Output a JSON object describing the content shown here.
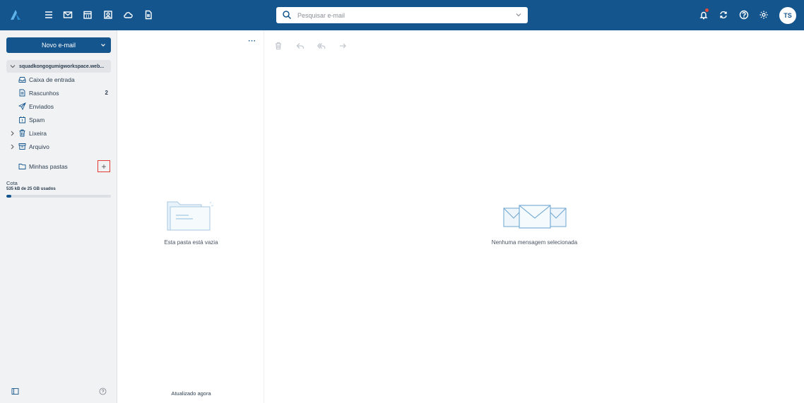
{
  "topbar": {
    "search_placeholder": "Pesquisar e-mail",
    "avatar_initials": "TS",
    "nav_icons": [
      "menu-icon",
      "mail-icon",
      "calendar-icon",
      "contacts-icon",
      "cloud-icon",
      "document-icon"
    ],
    "right_icons": [
      "bell-icon",
      "sync-icon",
      "help-icon",
      "settings-icon"
    ],
    "accent_color": "#14558d",
    "notification_dot_color": "#e74c3c"
  },
  "sidebar": {
    "new_mail_label": "Novo e-mail",
    "account_label": "squadkongogumigworkspace.web...",
    "folders": [
      {
        "label": "Caixa de entrada",
        "icon": "inbox-icon",
        "count": ""
      },
      {
        "label": "Rascunhos",
        "icon": "draft-icon",
        "count": "2"
      },
      {
        "label": "Enviados",
        "icon": "send-icon",
        "count": ""
      },
      {
        "label": "Spam",
        "icon": "spam-icon",
        "count": ""
      },
      {
        "label": "Lixeira",
        "icon": "trash-icon",
        "count": ""
      },
      {
        "label": "Arquivo",
        "icon": "archive-icon",
        "count": ""
      }
    ],
    "my_folders_label": "Minhas pastas",
    "quota_label": "Cota",
    "quota_usage": "535 kB de 25 GB usados",
    "quota_fraction": 0.05
  },
  "list": {
    "more_label": "···",
    "empty_text": "Esta pasta está vazia",
    "updated_text": "Atualizado agora"
  },
  "reading": {
    "no_selection_text": "Nenhuma mensagem selecionada",
    "toolbar_icons": [
      "delete-icon",
      "reply-icon",
      "reply-all-icon",
      "forward-icon"
    ]
  }
}
